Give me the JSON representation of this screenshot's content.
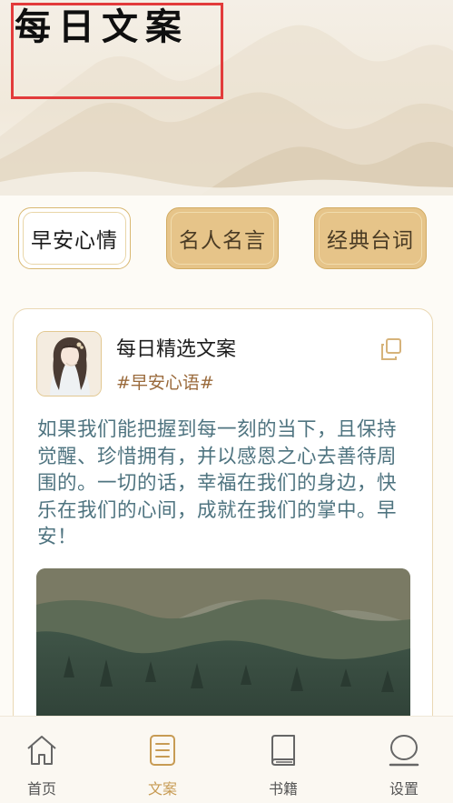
{
  "header": {
    "title": "每日文案"
  },
  "tabs": [
    {
      "label": "早安心情",
      "active": true
    },
    {
      "label": "名人名言",
      "active": false
    },
    {
      "label": "经典台词",
      "active": false
    }
  ],
  "card": {
    "title": "每日精选文案",
    "tag": "#早安心语#",
    "text": "如果我们能把握到每一刻的当下，且保持觉醒、珍惜拥有，并以感恩之心去善待周围的。一切的话，幸福在我们的身边，快乐在我们的心间，成就在我们的掌中。早安！"
  },
  "bottom_nav": {
    "items": [
      {
        "label": "首页",
        "icon": "home-icon",
        "active": false
      },
      {
        "label": "文案",
        "icon": "document-icon",
        "active": true
      },
      {
        "label": "书籍",
        "icon": "book-icon",
        "active": false
      },
      {
        "label": "设置",
        "icon": "settings-icon",
        "active": false
      }
    ]
  },
  "colors": {
    "accent_gold": "#e6c489",
    "active_nav": "#c79b54",
    "text_teal": "#4f7480",
    "tag_brown": "#9a6a3b",
    "highlight_box": "#e23b3b"
  }
}
